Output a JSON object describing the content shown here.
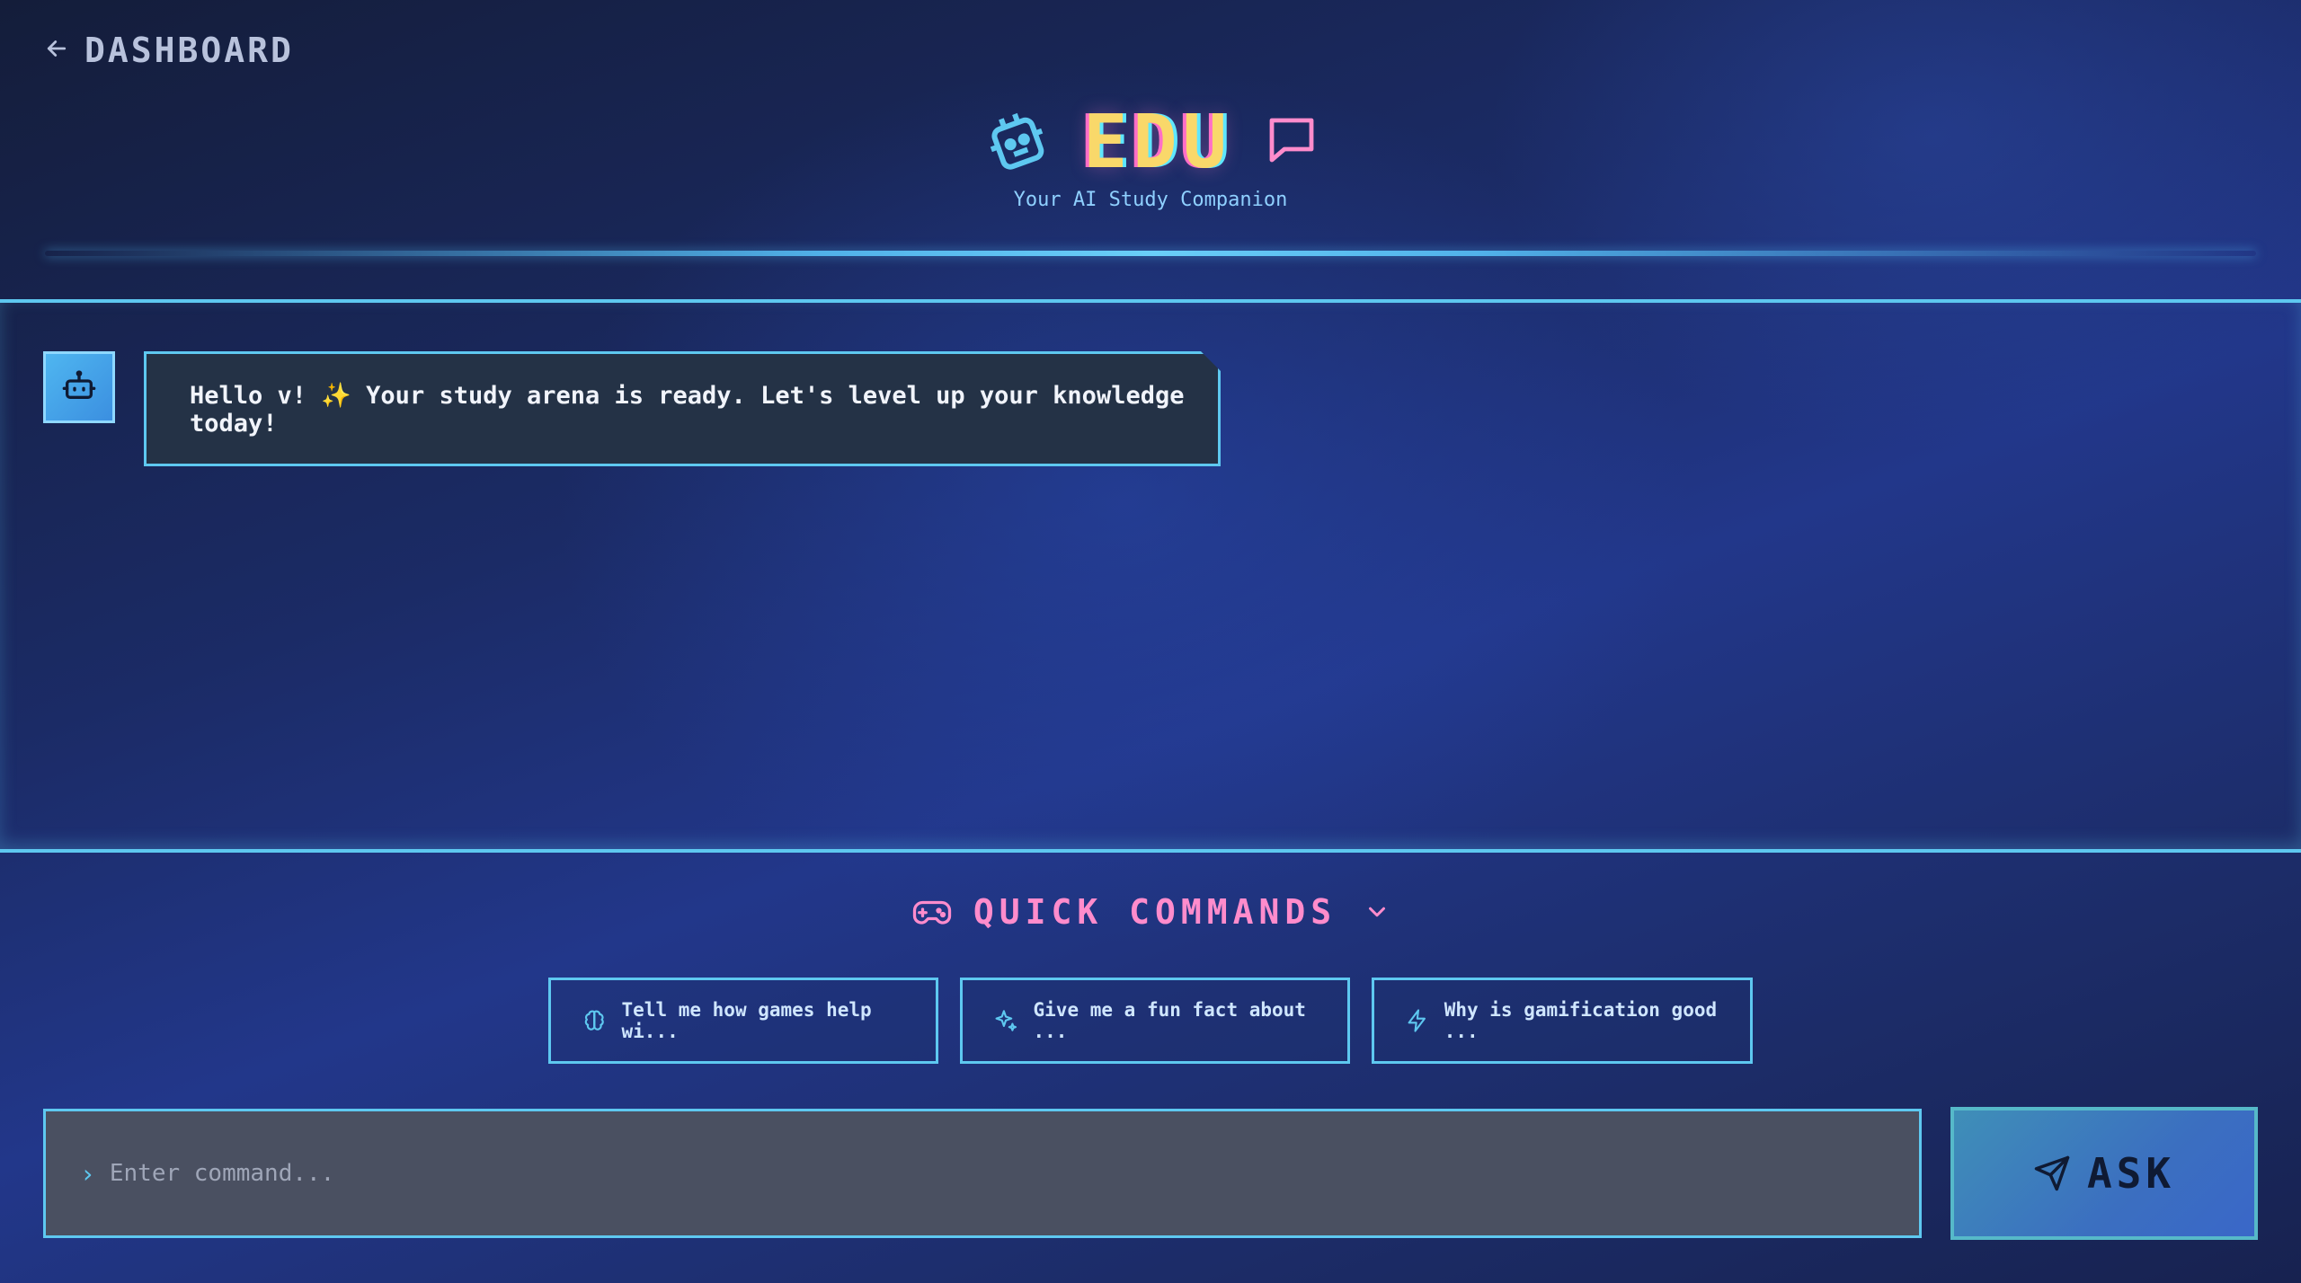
{
  "nav": {
    "back_label": "DASHBOARD",
    "back_icon": "arrow-left-icon"
  },
  "header": {
    "title": "EDU",
    "subtitle": "Your AI Study Companion",
    "left_icon": "robot-icon",
    "right_icon": "chat-bubble-icon"
  },
  "chat": {
    "messages": [
      {
        "sender": "bot",
        "avatar_icon": "bot-icon",
        "text": "Hello v! ✨ Your study arena is ready. Let's level up your knowledge today!"
      }
    ]
  },
  "quick_commands": {
    "title": "QUICK COMMANDS",
    "icon": "gamepad-icon",
    "toggle_icon": "chevron-down-icon",
    "items": [
      {
        "label": "Tell me how games help wi...",
        "icon": "brain-icon"
      },
      {
        "label": "Give me a fun fact about ...",
        "icon": "sparkle-icon"
      },
      {
        "label": "Why is gamification good ...",
        "icon": "lightning-icon"
      }
    ]
  },
  "composer": {
    "prompt_symbol": "›",
    "placeholder": "Enter command...",
    "value": "",
    "send_label": "ASK",
    "send_icon": "send-icon"
  },
  "colors": {
    "accent_cyan": "#5ec8f0",
    "accent_pink": "#ff8ccc",
    "title_yellow": "#f9d86a",
    "bg_dark": "#141d3a",
    "bg_mid": "#22378a"
  }
}
